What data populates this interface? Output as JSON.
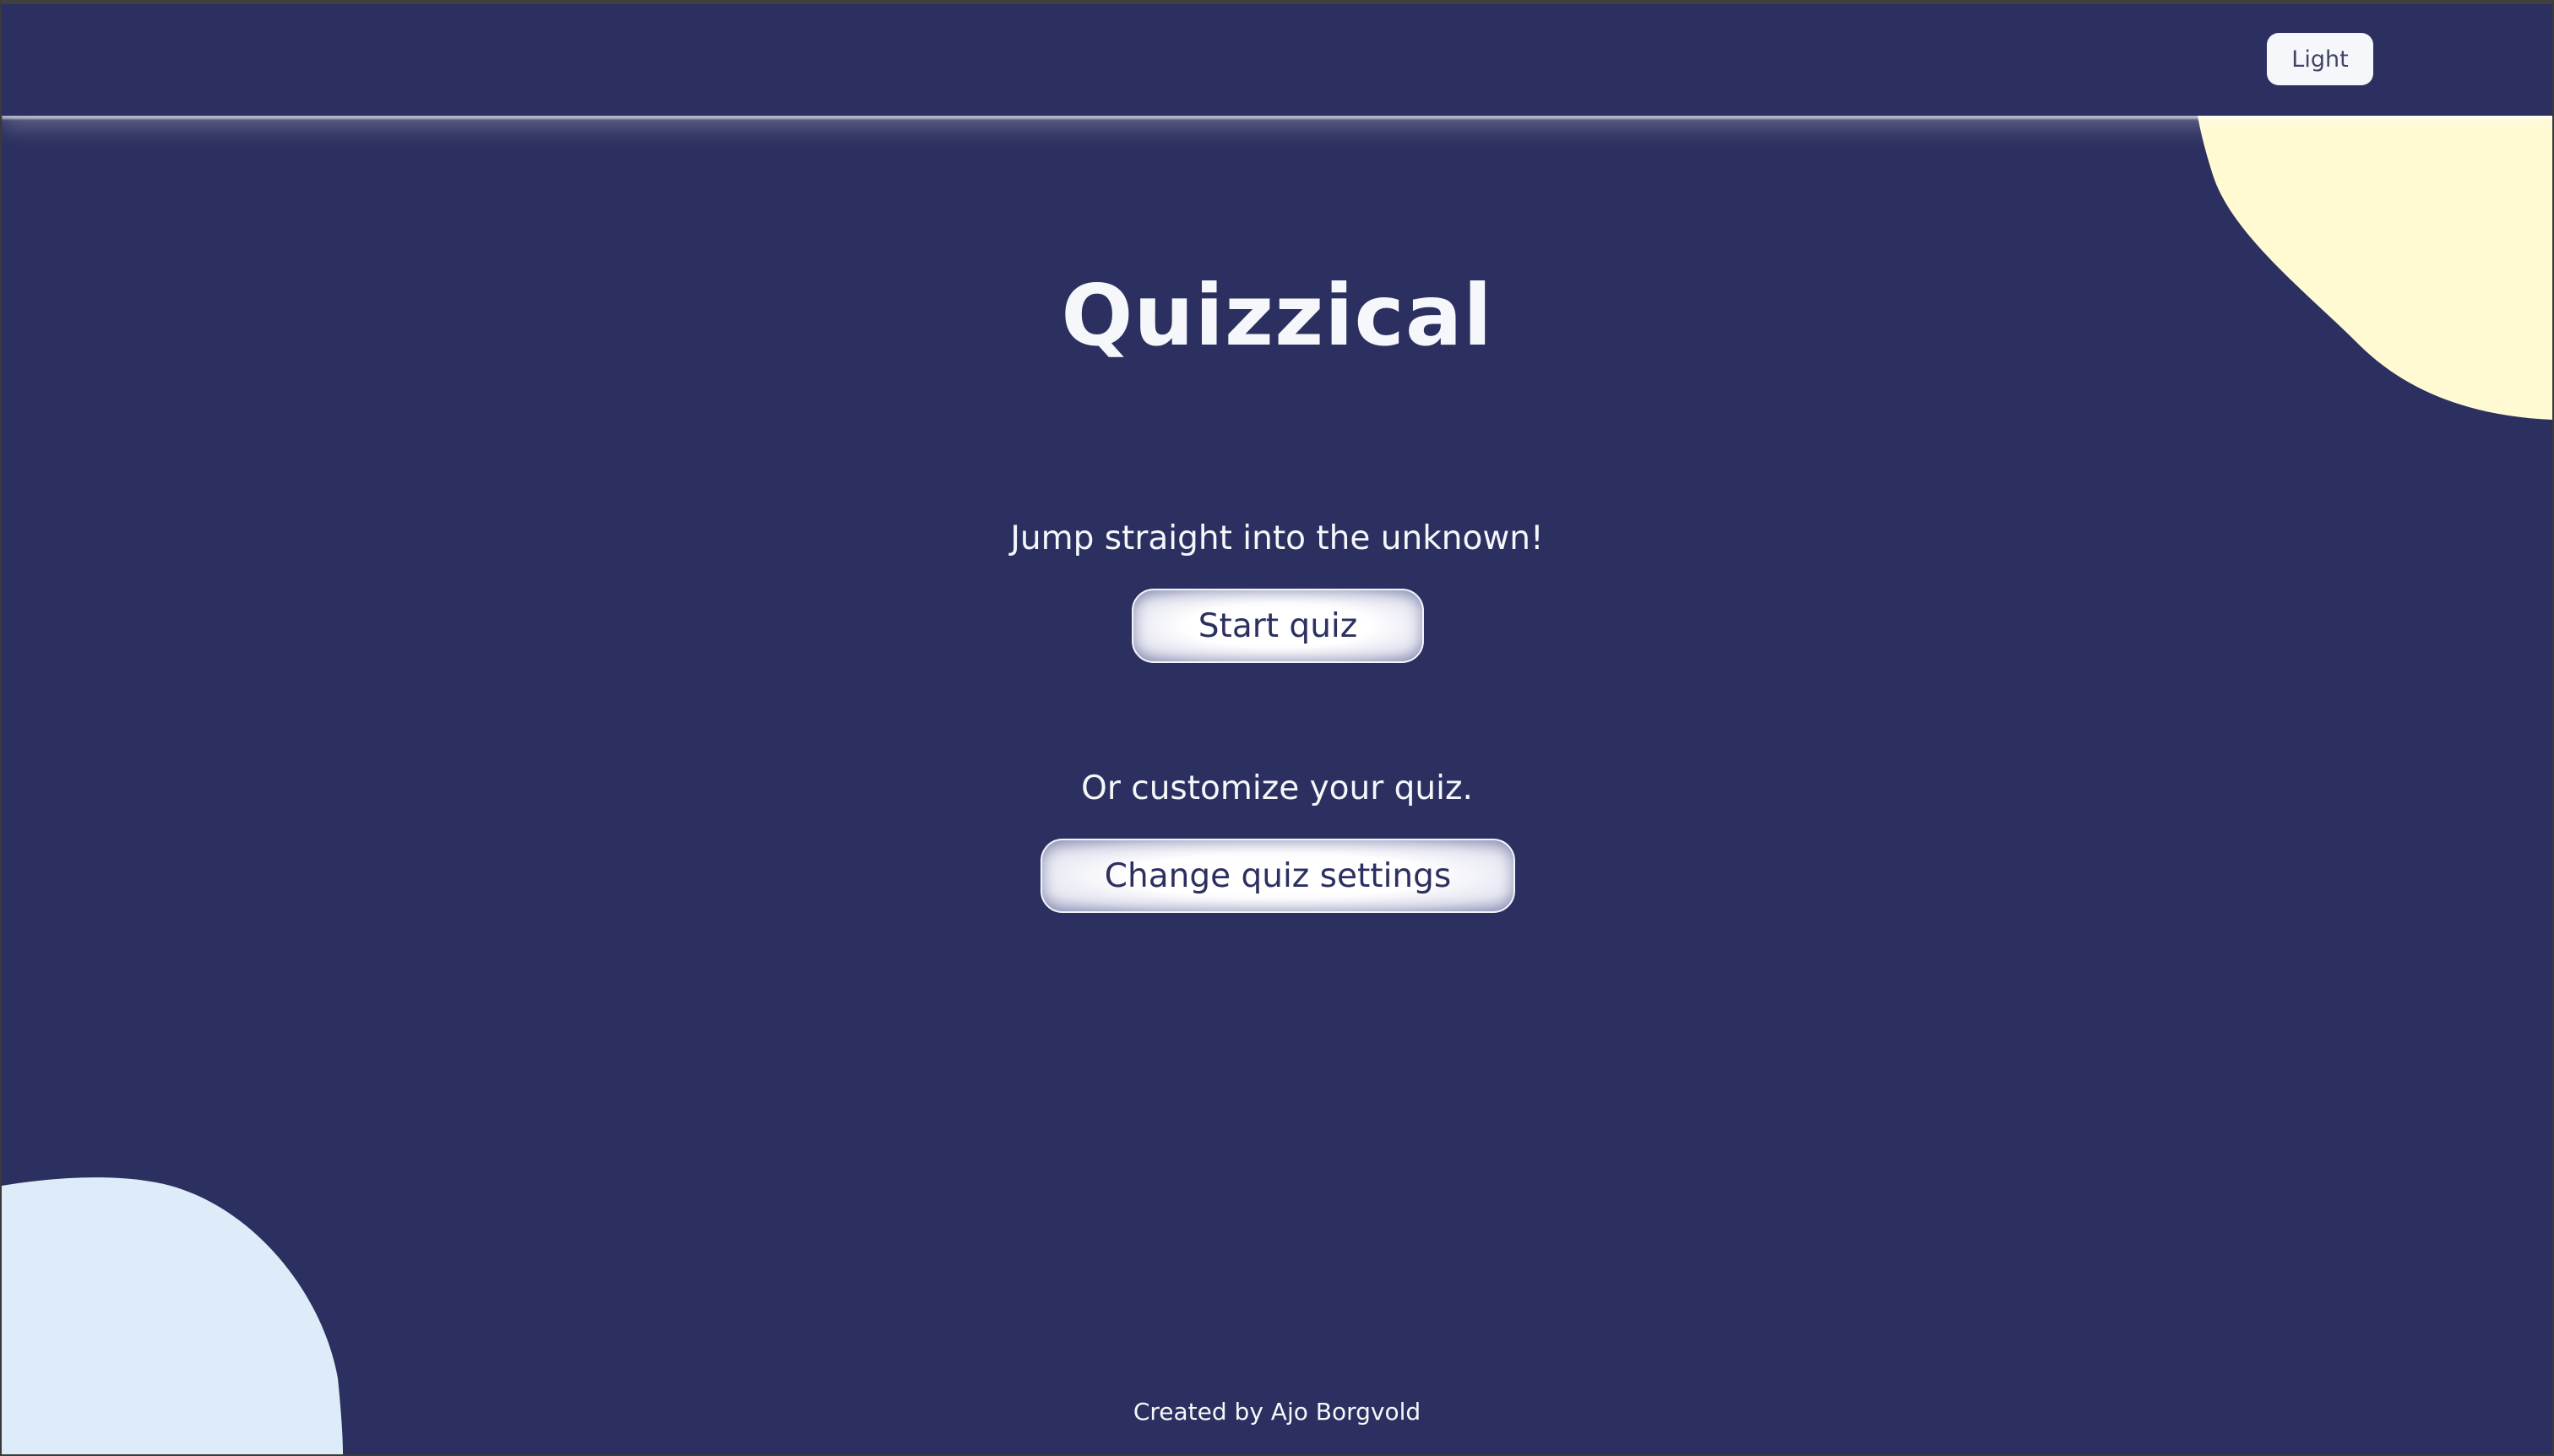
{
  "header": {
    "theme_toggle_label": "Light"
  },
  "main": {
    "title": "Quizzical",
    "quick_start": {
      "prompt": "Jump straight into the unknown!",
      "button_label": "Start quiz"
    },
    "customize": {
      "prompt": "Or customize your quiz.",
      "button_label": "Change quiz settings"
    }
  },
  "footer": {
    "credit": "Created by Ajo Borgvold"
  },
  "colors": {
    "background": "#2b3060",
    "text": "#f5f7fb",
    "blob_yellow": "#fffad1",
    "blob_blue": "#deebf8",
    "button_text": "#2b3060"
  }
}
